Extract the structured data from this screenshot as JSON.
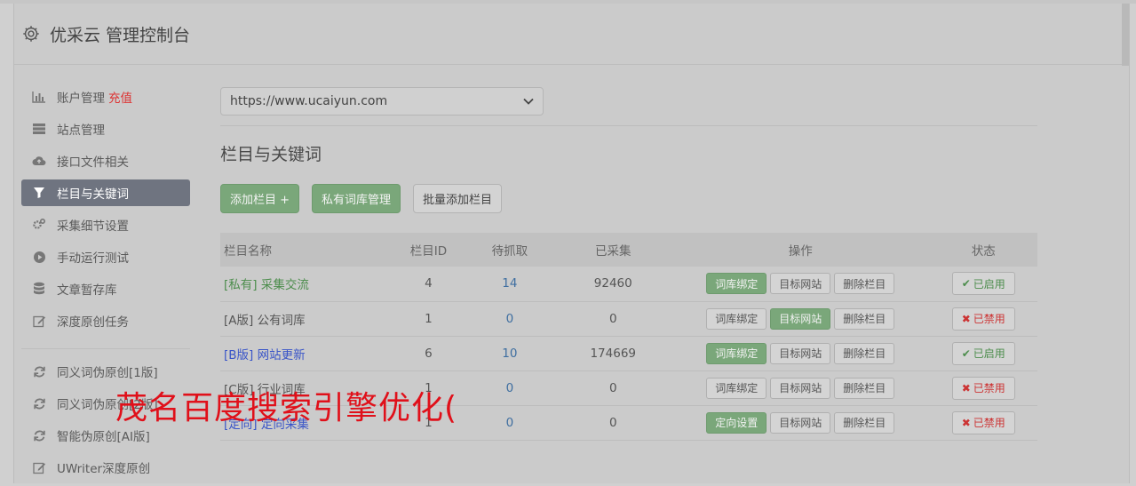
{
  "header": {
    "title": "优采云 管理控制台"
  },
  "sidebar": {
    "items": [
      {
        "label": "账户管理",
        "badge": "充值",
        "icon": "bar-chart-icon"
      },
      {
        "label": "站点管理",
        "icon": "server-icon"
      },
      {
        "label": "接口文件相关",
        "icon": "cloud-upload-icon"
      },
      {
        "label": "栏目与关键词",
        "icon": "filter-icon",
        "active": true
      },
      {
        "label": "采集细节设置",
        "icon": "gears-icon"
      },
      {
        "label": "手动运行测试",
        "icon": "play-circle-icon"
      },
      {
        "label": "文章暂存库",
        "icon": "database-icon"
      },
      {
        "label": "深度原创任务",
        "icon": "edit-icon"
      }
    ],
    "items2": [
      {
        "label": "同义词伪原创[1版]",
        "icon": "refresh-icon"
      },
      {
        "label": "同义词伪原创[2版]",
        "icon": "refresh-icon"
      },
      {
        "label": "智能伪原创[AI版]",
        "icon": "refresh-icon"
      },
      {
        "label": "UWriter深度原创",
        "icon": "edit-icon"
      }
    ]
  },
  "main": {
    "site_select": {
      "value": "https://www.ucaiyun.com"
    },
    "section_title": "栏目与关键词",
    "buttons": {
      "add": "添加栏目 +",
      "private_lib": "私有词库管理",
      "batch_add": "批量添加栏目"
    },
    "table": {
      "headers": [
        "栏目名称",
        "栏目ID",
        "待抓取",
        "已采集",
        "操作",
        "状态"
      ],
      "rows": [
        {
          "tag": "[私有]",
          "name": "采集交流",
          "tag_color": "green",
          "id": "4",
          "pending": "14",
          "collected": "92460",
          "op1": "词库绑定",
          "op1_active": true,
          "op2": "目标网站",
          "op2_active": false,
          "op3": "删除栏目",
          "status": "已启用",
          "status_on": true
        },
        {
          "tag": "[A版]",
          "name": "公有词库",
          "tag_color": "plain",
          "id": "1",
          "pending": "0",
          "collected": "0",
          "op1": "词库绑定",
          "op1_active": false,
          "op2": "目标网站",
          "op2_active": true,
          "op3": "删除栏目",
          "status": "已禁用",
          "status_on": false
        },
        {
          "tag": "[B版]",
          "name": "网站更新",
          "tag_color": "blue",
          "id": "6",
          "pending": "10",
          "collected": "174669",
          "op1": "词库绑定",
          "op1_active": true,
          "op2": "目标网站",
          "op2_active": false,
          "op3": "删除栏目",
          "status": "已启用",
          "status_on": true
        },
        {
          "tag": "[C版]",
          "name": "行业词库",
          "tag_color": "plain",
          "id": "1",
          "pending": "0",
          "collected": "0",
          "op1": "词库绑定",
          "op1_active": false,
          "op2": "目标网站",
          "op2_active": false,
          "op3": "删除栏目",
          "status": "已禁用",
          "status_on": false
        },
        {
          "tag": "[定向]",
          "name": "定向采集",
          "tag_color": "blue",
          "id": "1",
          "pending": "0",
          "collected": "0",
          "op1": "定向设置",
          "op1_active": true,
          "op2": "目标网站",
          "op2_active": false,
          "op3": "删除栏目",
          "status": "已禁用",
          "status_on": false
        }
      ]
    }
  },
  "overlay_text": "茂名百度搜索引擎优化("
}
